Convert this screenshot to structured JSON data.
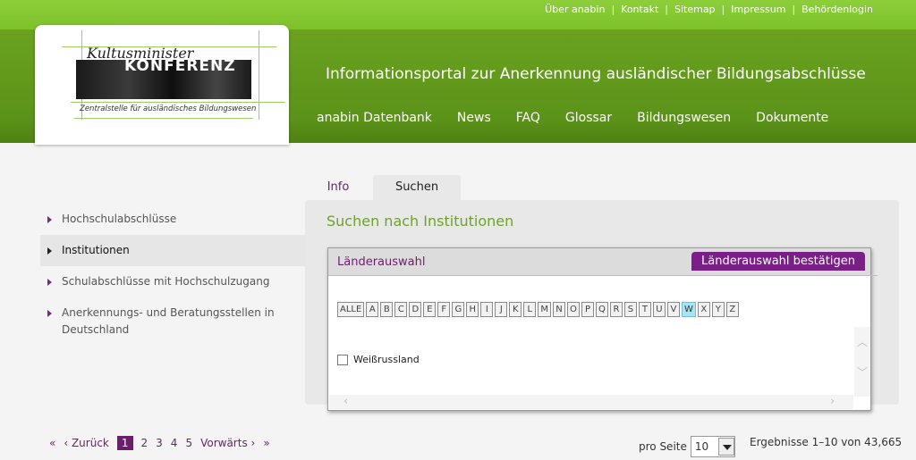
{
  "top_links": [
    "Über anabin",
    "Kontakt",
    "Sitemap",
    "Impressum",
    "Behördenlogin"
  ],
  "header": {
    "title": "Informationsportal zur Anerkennung ausländischer Bildungsabschlüsse",
    "nav": [
      "anabin Datenbank",
      "News",
      "FAQ",
      "Glossar",
      "Bildungswesen",
      "Dokumente"
    ]
  },
  "logo": {
    "line1": "Kultusminister",
    "line2": "KONFERENZ",
    "subtitle": "Zentralstelle für ausländisches Bildungswesen"
  },
  "sidebar": {
    "items": [
      {
        "label": "Hochschulabschlüsse",
        "active": false
      },
      {
        "label": "Institutionen",
        "active": true
      },
      {
        "label": "Schulabschlüsse mit Hochschulzugang",
        "active": false
      },
      {
        "label": "Anerkennungs- und Beratungsstellen in Deutschland",
        "active": false
      }
    ]
  },
  "tabs": {
    "info": "Info",
    "suchen": "Suchen"
  },
  "panel": {
    "title": "Suchen nach Institutionen"
  },
  "dialog": {
    "title": "Länderauswahl",
    "confirm_label": "Länderauswahl bestätigen",
    "letters": [
      "ALLE",
      "A",
      "B",
      "C",
      "D",
      "E",
      "F",
      "G",
      "H",
      "I",
      "J",
      "K",
      "L",
      "M",
      "N",
      "O",
      "P",
      "Q",
      "R",
      "S",
      "T",
      "U",
      "V",
      "W",
      "X",
      "Y",
      "Z"
    ],
    "selected_letter": "W",
    "countries": [
      "Weißrussland"
    ]
  },
  "pagination": {
    "first": "«",
    "prev": "‹ Zurück",
    "pages": [
      "1",
      "2",
      "3",
      "4",
      "5"
    ],
    "current": "1",
    "next": "Vorwärts ›",
    "last": "»",
    "per_page_label": "pro Seite",
    "per_page_value": "10",
    "results_text": "Ergebnisse 1–10 von 43,665"
  },
  "colors": {
    "green_top": "#7dc12a",
    "green_header": "#5b9219",
    "purple": "#6b1f6b",
    "button_purple": "#7b1f88",
    "title_green": "#6ea12e"
  }
}
